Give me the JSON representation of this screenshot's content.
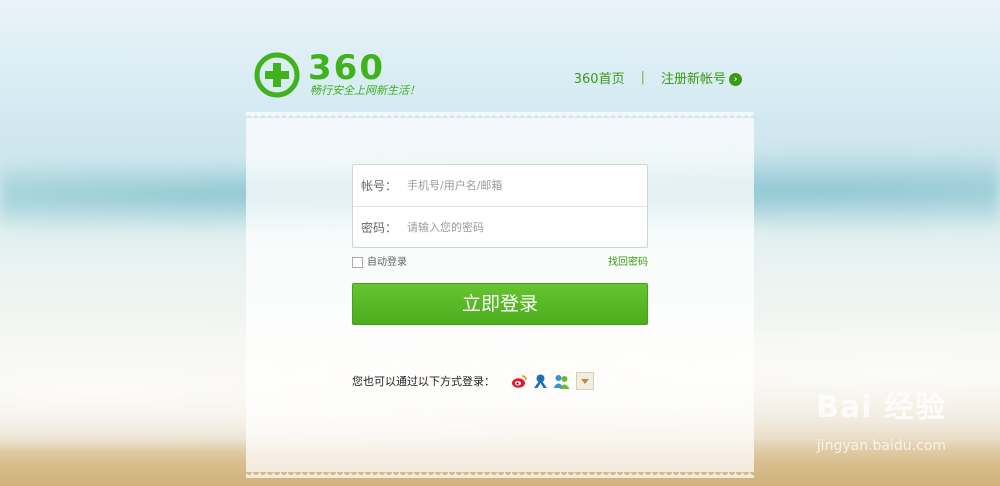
{
  "brand": {
    "logo_text": "360",
    "slogan": "畅行安全上网新生活！",
    "accent_color": "#3fb21c"
  },
  "nav": {
    "home_label": "360首页",
    "separator": "|",
    "register_label": "注册新帐号",
    "register_icon": "chevron-right-circle-icon"
  },
  "form": {
    "account_label": "帐号：",
    "account_placeholder": "手机号/用户名/邮箱",
    "password_label": "密码：",
    "password_placeholder": "请输入您的密码",
    "auto_login_label": "自动登录",
    "forgot_label": "找回密码",
    "submit_label": "立即登录"
  },
  "social": {
    "prompt": "您也可以通过以下方式登录：",
    "providers": [
      "weibo-icon",
      "qq-icon",
      "people-icon"
    ],
    "more_icon": "chevron-down-icon"
  },
  "watermark": {
    "text": "Bai 经验",
    "sub": "jingyan.baidu.com"
  }
}
